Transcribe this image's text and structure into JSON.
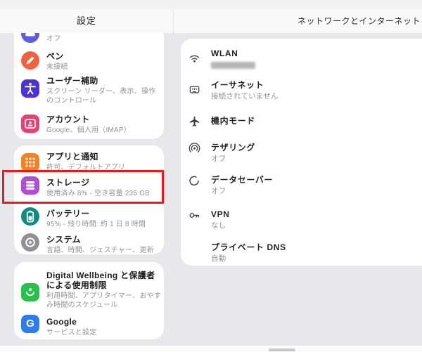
{
  "header": {
    "settings_title": "設定",
    "network_title": "ネットワークとインターネット"
  },
  "left_items": [
    {
      "title": "",
      "subtitle": "オフ",
      "icon": "hidden-top-icon",
      "icon_color": "#5a5de0"
    },
    {
      "title": "ペン",
      "subtitle": "未接続",
      "icon": "pen-icon",
      "icon_color": "#f4613f"
    },
    {
      "title": "ユーザー補助",
      "subtitle": "スクリーン リーダー、表示、操作のコントロール",
      "icon": "accessibility-icon",
      "icon_color": "#4c33d4"
    },
    {
      "title": "アカウント",
      "subtitle": "Google、個人用（IMAP）",
      "icon": "account-icon",
      "icon_color": "#ec3f72"
    },
    {
      "title": "アプリと通知",
      "subtitle": "許可、デフォルトアプリ",
      "icon": "apps-icon",
      "icon_color": "#f5821f"
    },
    {
      "title": "ストレージ",
      "subtitle": "使用済み 8% - 空き容量 235 GB",
      "icon": "storage-icon",
      "icon_color": "#b14fd4",
      "highlighted": true
    },
    {
      "title": "バッテリー",
      "subtitle": "95% - 残り時間: 約 1 日 8 時間",
      "icon": "battery-icon",
      "icon_color": "#0e8c7f"
    },
    {
      "title": "システム",
      "subtitle": "言語、時間、ジェスチャー、更新",
      "icon": "system-icon",
      "icon_color": "#8f9194"
    },
    {
      "title": "Digital Wellbeing と保護者による使用制限",
      "subtitle": "利用時間、アプリタイマー、おやすみ時間のスケジュール",
      "icon": "wellbeing-icon",
      "icon_color": "#27c24c"
    },
    {
      "title": "Google",
      "subtitle": "サービスと設定",
      "icon": "google-icon",
      "icon_color": "#2e7df0",
      "icon_letter": "G"
    }
  ],
  "right_items": [
    {
      "title": "WLAN",
      "subtitle": "",
      "subtitle_redacted": true,
      "icon": "wifi-icon"
    },
    {
      "title": "イーサネット",
      "subtitle": "接続されていません",
      "icon": "ethernet-icon"
    },
    {
      "title": "機内モード",
      "subtitle": "",
      "icon": "airplane-icon"
    },
    {
      "title": "テザリング",
      "subtitle": "オフ",
      "icon": "tethering-icon"
    },
    {
      "title": "データセーバー",
      "subtitle": "オフ",
      "icon": "data-saver-icon"
    },
    {
      "title": "VPN",
      "subtitle": "なし",
      "icon": "vpn-icon"
    },
    {
      "title": "プライベート DNS",
      "subtitle": "自動",
      "icon": ""
    }
  ],
  "highlight": {
    "color": "#e8191f",
    "target": "ストレージ"
  }
}
